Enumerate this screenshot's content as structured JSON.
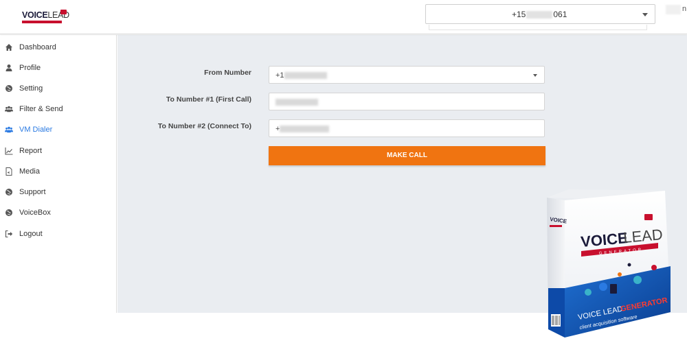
{
  "header": {
    "logo": {
      "word_bold": "VOICE",
      "word_light": "LEAD"
    },
    "phone_select": {
      "prefix": "+15",
      "suffix": "061"
    },
    "corner_char": "n"
  },
  "sidebar": {
    "items": [
      {
        "label": "Dashboard",
        "icon": "home-icon",
        "active": false
      },
      {
        "label": "Profile",
        "icon": "user-icon",
        "active": false
      },
      {
        "label": "Setting",
        "icon": "globe-icon",
        "active": false
      },
      {
        "label": "Filter & Send",
        "icon": "users-icon",
        "active": false
      },
      {
        "label": "VM Dialer",
        "icon": "users-icon",
        "active": true
      },
      {
        "label": "Report",
        "icon": "line-chart-icon",
        "active": false
      },
      {
        "label": "Media",
        "icon": "file-audio-icon",
        "active": false
      },
      {
        "label": "Support",
        "icon": "globe-icon",
        "active": false
      },
      {
        "label": "VoiceBox",
        "icon": "globe-icon",
        "active": false
      },
      {
        "label": "Logout",
        "icon": "sign-out-icon",
        "active": false
      }
    ]
  },
  "form": {
    "from_number": {
      "label": "From Number",
      "value": "+1"
    },
    "to_number_1": {
      "label": "To Number #1 (First Call)",
      "value": ""
    },
    "to_number_2": {
      "label": "To Number #2 (Connect To)",
      "value": "+"
    },
    "make_call_label": "MAKE CALL"
  },
  "product_box": {
    "brand_bold": "VOICE",
    "brand_light": "LEAD",
    "ribbon": "GENERATOR",
    "side_text_1": "VOICE LEAD",
    "side_text_2": "GENERATOR",
    "side_text_3": "client acquisition software"
  },
  "colors": {
    "accent_orange": "#f07411",
    "active_blue": "#2a7ae2",
    "main_bg": "#eaedf1",
    "brand_red": "#c8102e"
  }
}
